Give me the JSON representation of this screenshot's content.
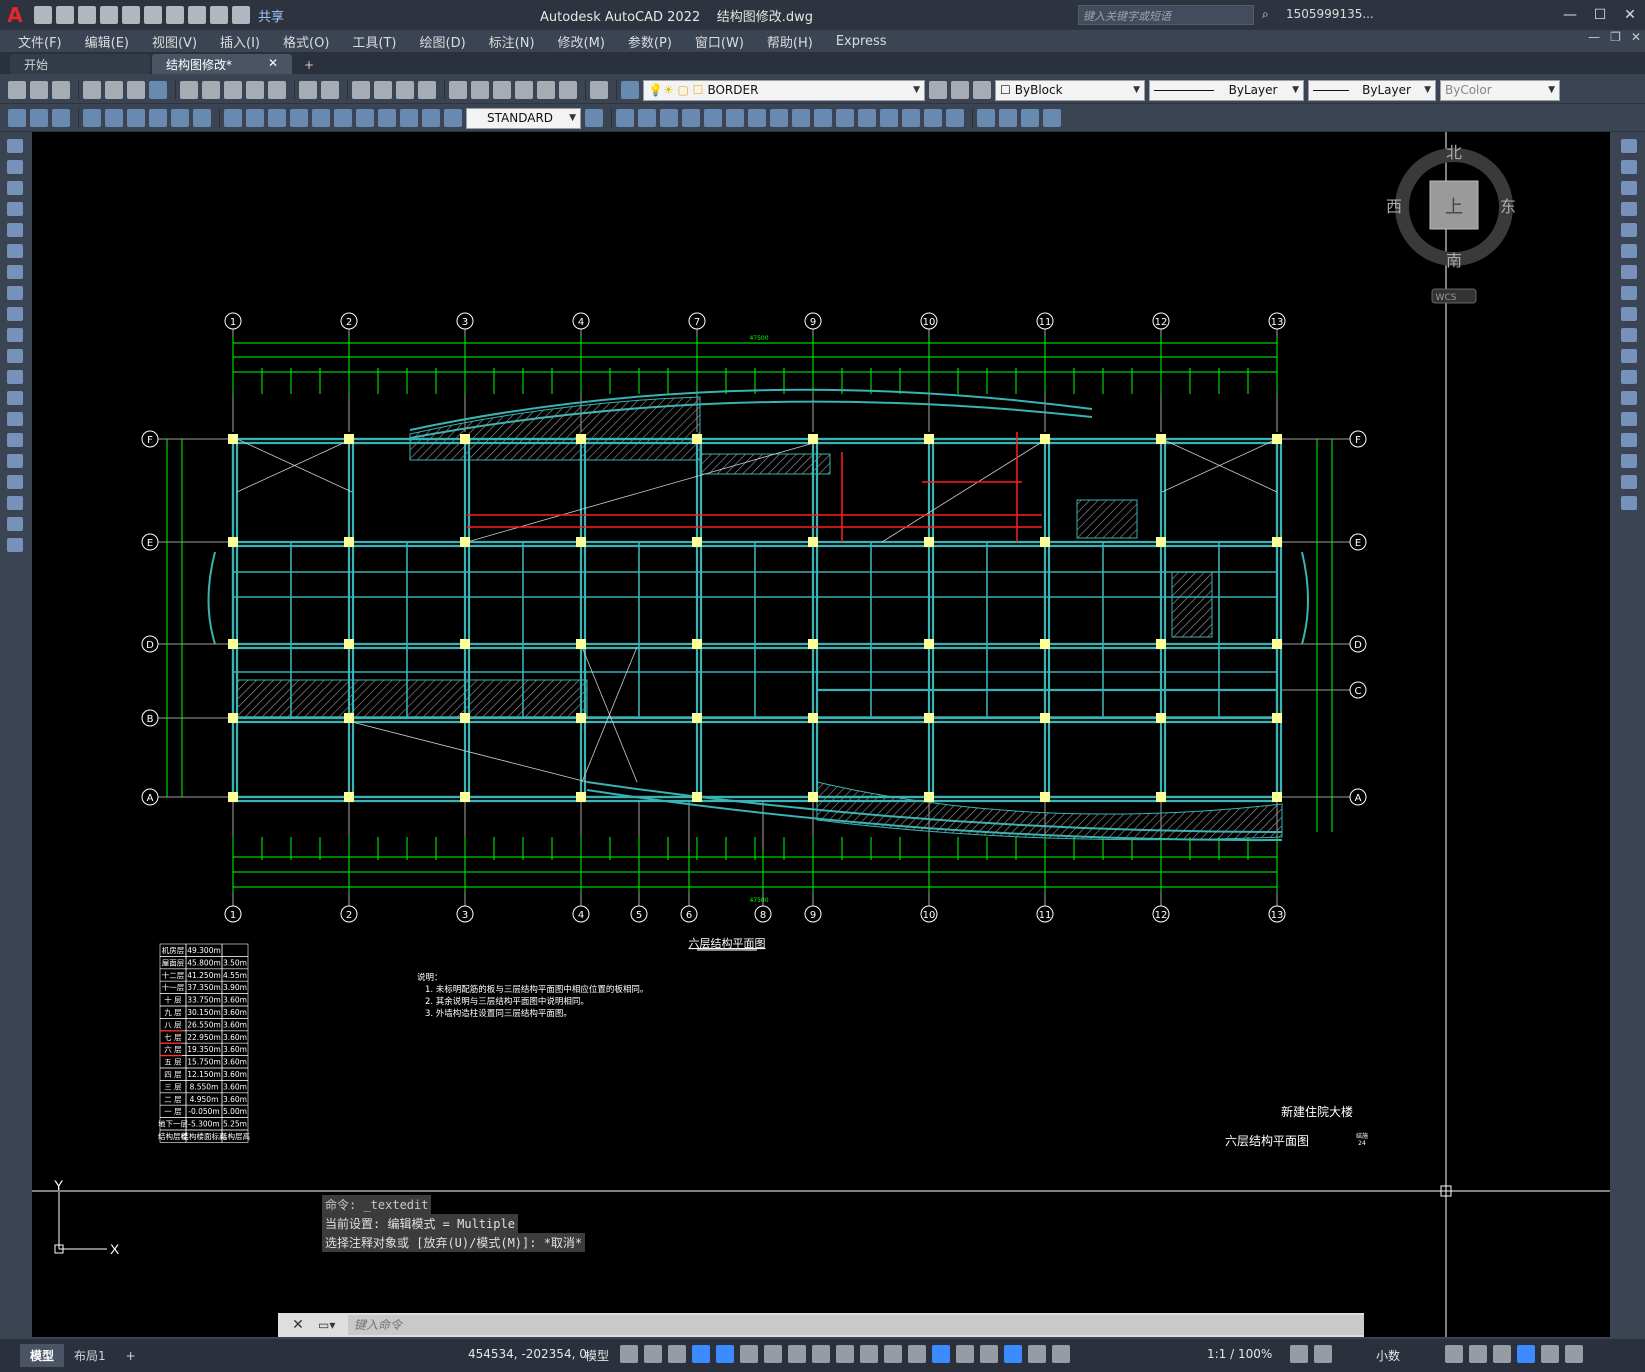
{
  "app": {
    "logo": "A",
    "title": "Autodesk AutoCAD 2022",
    "document": "结构图修改.dwg",
    "share": "共享",
    "search_placeholder": "键入关键字或短语",
    "user": "1505999135...",
    "win_buttons": [
      "—",
      "☐",
      "✕"
    ]
  },
  "menu": [
    "文件(F)",
    "编辑(E)",
    "视图(V)",
    "插入(I)",
    "格式(O)",
    "工具(T)",
    "绘图(D)",
    "标注(N)",
    "修改(M)",
    "参数(P)",
    "窗口(W)",
    "帮助(H)",
    "Express"
  ],
  "tabs": {
    "items": [
      {
        "label": "开始",
        "active": false
      },
      {
        "label": "结构图修改*",
        "active": true,
        "close": "✕"
      }
    ],
    "add": "+"
  },
  "toolbar": {
    "layer": "BORDER",
    "color": "ByBlock",
    "linetype": "ByLayer",
    "lineweight": "ByLayer",
    "plotstyle": "ByColor",
    "textstyle": "STANDARD"
  },
  "viewcube": {
    "north": "北",
    "south": "南",
    "west": "西",
    "east": "东",
    "top": "上",
    "wcs": "WCS"
  },
  "drawing": {
    "title": "六层结构平面图",
    "grid_columns_top": [
      "1",
      "2",
      "3",
      "4",
      "7",
      "9",
      "10",
      "11",
      "12",
      "13"
    ],
    "grid_columns_bottom": [
      "1",
      "2",
      "3",
      "4",
      "5",
      "6",
      "8",
      "9",
      "10",
      "11",
      "12",
      "13"
    ],
    "grid_rows_left": [
      "F",
      "E",
      "D",
      "B",
      "A"
    ],
    "grid_rows_right": [
      "F",
      "E",
      "D",
      "C",
      "A"
    ],
    "total_dimension": "47500",
    "notes_title": "说明：",
    "notes": [
      "1. 未标明配筋的板与三层结构平面图中相应位置的板相同。",
      "2. 其余说明与三层结构平面图中说明相同。",
      "3. 外墙构造柱设置同三层结构平面图。"
    ],
    "floor_table": [
      [
        "机房层",
        "49.300m",
        ""
      ],
      [
        "屋面层",
        "45.800m",
        "3.50m"
      ],
      [
        "十二层",
        "41.250m",
        "4.55m"
      ],
      [
        "十一层",
        "37.350m",
        "3.90m"
      ],
      [
        "十 层",
        "33.750m",
        "3.60m"
      ],
      [
        "九 层",
        "30.150m",
        "3.60m"
      ],
      [
        "八 层",
        "26.550m",
        "3.60m"
      ],
      [
        "七 层",
        "22.950m",
        "3.60m"
      ],
      [
        "六 层",
        "19.350m",
        "3.60m"
      ],
      [
        "五 层",
        "15.750m",
        "3.60m"
      ],
      [
        "四 层",
        "12.150m",
        "3.60m"
      ],
      [
        "三 层",
        "8.550m",
        "3.60m"
      ],
      [
        "二 层",
        "4.950m",
        "3.60m"
      ],
      [
        "一 层",
        "-0.050m",
        "5.00m"
      ],
      [
        "地下一层",
        "-5.300m",
        "5.25m"
      ],
      [
        "结构层楼",
        "结构楼面标高",
        "结构层高"
      ]
    ],
    "project_name": "新建住院大楼",
    "sheet_name": "六层结构平面图",
    "sheet_no": "结施",
    "sheet_num": "24"
  },
  "command": {
    "history": [
      "命令: _textedit",
      "当前设置: 编辑模式 = Multiple",
      "选择注释对象或 [放弃(U)/模式(M)]: *取消*"
    ],
    "placeholder": "键入命令",
    "close": "✕"
  },
  "status": {
    "tabs": [
      "模型",
      "布局1"
    ],
    "add": "+",
    "coords": "454534, -202354, 0",
    "model": "模型",
    "annoscale": "1:1 / 100%",
    "units": "小数"
  },
  "colors": {
    "canvas": "#000000",
    "cad_green": "#00ff00",
    "cad_cyan": "#39b3b3",
    "cad_red": "#ff0000",
    "cad_yellow": "#ffff99",
    "ui_bg": "#3b4453"
  }
}
